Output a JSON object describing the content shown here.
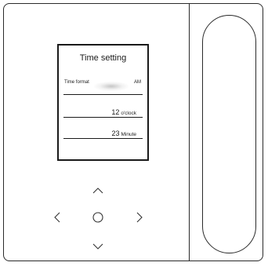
{
  "screen": {
    "title": "Time setting",
    "format_label": "Time format",
    "format_value": "AM",
    "hour_value": "12",
    "hour_unit": "o'clock",
    "minute_value": "23",
    "minute_unit": "Minute"
  },
  "icons": {
    "up": "chevron-up-icon",
    "down": "chevron-down-icon",
    "left": "chevron-left-icon",
    "right": "chevron-right-icon",
    "center": "circle-ok-icon"
  }
}
